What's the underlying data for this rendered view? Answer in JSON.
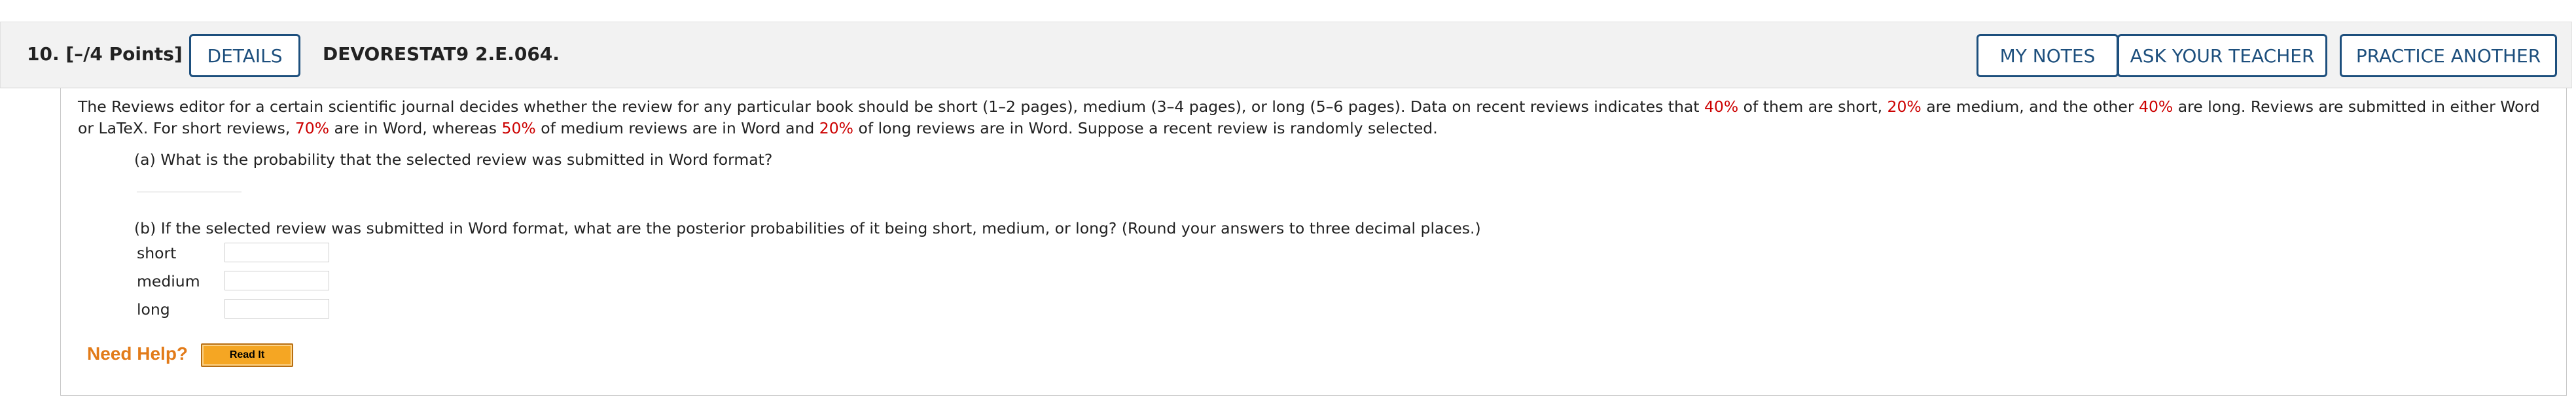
{
  "header": {
    "question_number": "10.",
    "points": "[–/4 Points]",
    "details_label": "DETAILS",
    "question_code": "DEVORESTAT9 2.E.064.",
    "my_notes_label": "MY NOTES",
    "ask_teacher_label": "ASK YOUR TEACHER",
    "practice_another_label": "PRACTICE ANOTHER"
  },
  "problem": {
    "t1": "The Reviews editor for a certain scientific journal decides whether the review for any particular book should be short (1–2 pages), medium (3–4 pages), or long (5–6 pages). Data on recent reviews indicates that ",
    "p_short": "40%",
    "t2": " of them are short, ",
    "p_medium": "20%",
    "t3": " are medium, and the other ",
    "p_long": "40%",
    "t4": " are long. Reviews are submitted in either Word or LaTeX. For short reviews, ",
    "w_short": "70%",
    "t5": " are in Word, whereas ",
    "w_medium": "50%",
    "t6": " of medium reviews are in Word and ",
    "w_long": "20%",
    "t7": " of long reviews are in Word. Suppose a recent review is randomly selected."
  },
  "part_a": {
    "question": "(a) What is the probability that the selected review was submitted in Word format?"
  },
  "part_b": {
    "question": "(b) If the selected review was submitted in Word format, what are the posterior probabilities of it being short, medium, or long? (Round your answers to three decimal places.)",
    "rows": [
      {
        "label": "short"
      },
      {
        "label": "medium"
      },
      {
        "label": "long"
      }
    ]
  },
  "help": {
    "need_help": "Need Help?",
    "read_it": "Read It"
  },
  "colors": {
    "accent": "#1d4f7d",
    "highlight": "#cc0000",
    "help": "#e27b19",
    "read_it_bg": "#f5a623"
  }
}
